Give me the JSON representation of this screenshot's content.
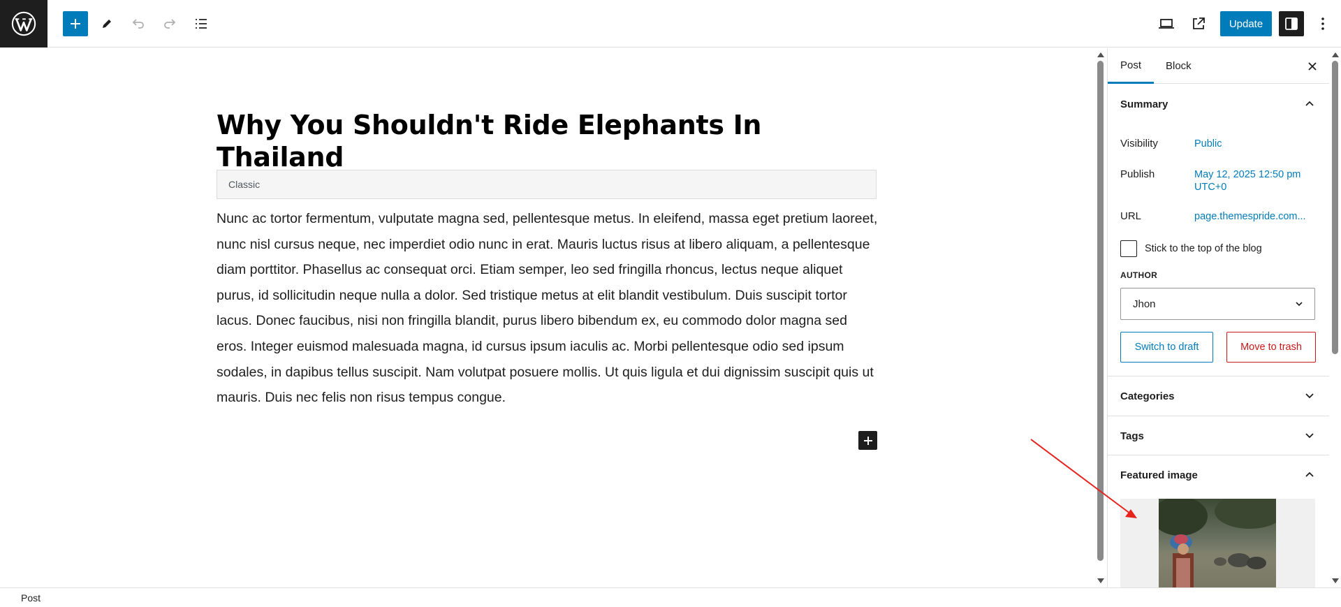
{
  "toolbar": {
    "update_label": "Update",
    "icons": [
      "wordpress-logo",
      "plus-icon",
      "pencil-icon",
      "undo-icon",
      "redo-icon",
      "document-overview-icon",
      "desktop-view-icon",
      "external-link-icon",
      "sidebar-icon",
      "more-options-icon"
    ]
  },
  "editor": {
    "title": "Why You Shouldn't Ride Elephants In Thailand",
    "classic_label": "Classic",
    "body": "Nunc ac tortor fermentum, vulputate magna sed, pellentesque metus. In eleifend, massa eget pretium laoreet, nunc nisl cursus neque, nec imperdiet odio nunc in erat. Mauris luctus risus at libero aliquam, a pellentesque diam porttitor. Phasellus ac consequat orci. Etiam semper, leo sed fringilla rhoncus, lectus neque aliquet purus, id sollicitudin neque nulla a dolor. Sed tristique metus at elit blandit vestibulum. Duis suscipit tortor lacus. Donec faucibus, nisi non fringilla blandit, purus libero bibendum ex, eu commodo dolor magna sed eros. Integer euismod malesuada magna, id cursus ipsum iaculis ac. Morbi pellentesque odio sed ipsum sodales, in dapibus tellus suscipit. Nam volutpat posuere mollis. Ut quis ligula et dui dignissim suscipit quis ut mauris. Duis nec felis non risus tempus congue."
  },
  "sidebar": {
    "tabs": [
      {
        "label": "Post",
        "active": true
      },
      {
        "label": "Block",
        "active": false
      }
    ],
    "summary": {
      "heading": "Summary",
      "visibility_label": "Visibility",
      "visibility_value": "Public",
      "publish_label": "Publish",
      "publish_value_line1": "May 12, 2025 12:50 pm",
      "publish_value_line2": "UTC+0",
      "url_label": "URL",
      "url_value": "page.themespride.com...",
      "sticky_label": "Stick to the top of the blog",
      "sticky_checked": false,
      "author_label": "AUTHOR",
      "author_value": "Jhon",
      "switch_draft_label": "Switch to draft",
      "move_trash_label": "Move to trash"
    },
    "panels": {
      "categories": "Categories",
      "tags": "Tags",
      "featured_image": "Featured image"
    }
  },
  "footer": {
    "breadcrumb": "Post"
  },
  "colors": {
    "accent": "#007cba",
    "danger": "#cc1818",
    "dark": "#1e1e1e",
    "annotation": "#e8231e"
  }
}
